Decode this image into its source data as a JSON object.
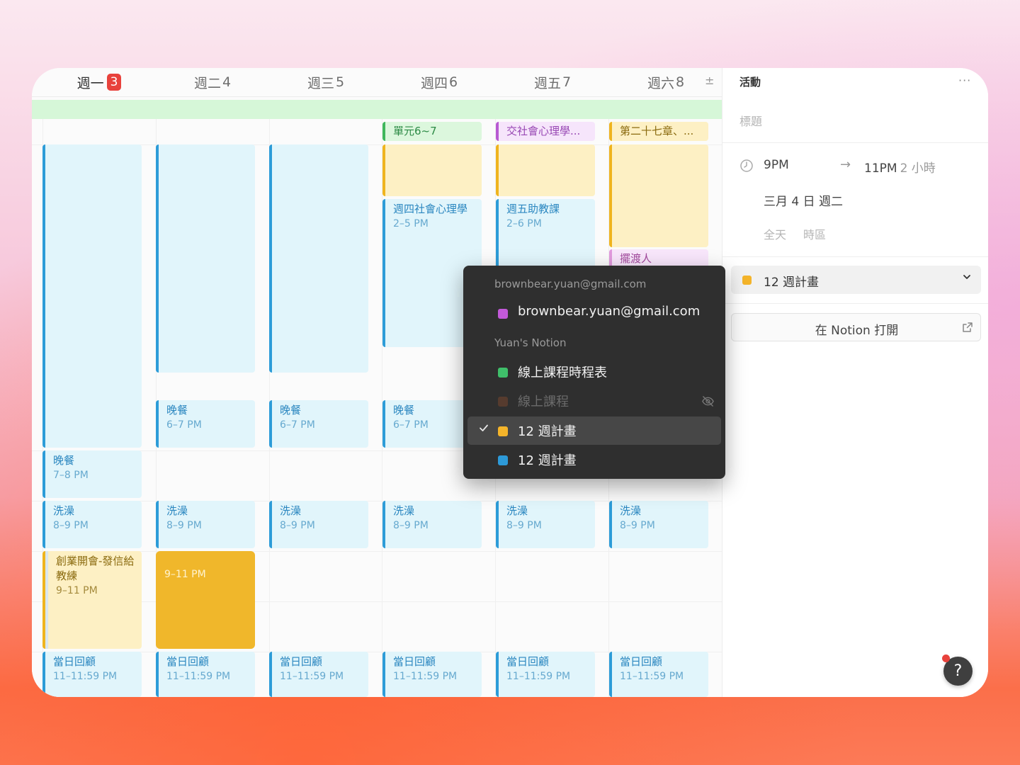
{
  "calendar": {
    "days": [
      {
        "name": "週一",
        "num": "3",
        "today": true
      },
      {
        "name": "週二",
        "num": "4"
      },
      {
        "name": "週三",
        "num": "5"
      },
      {
        "name": "週四",
        "num": "6"
      },
      {
        "name": "週五",
        "num": "7"
      },
      {
        "name": "週六",
        "num": "8"
      }
    ],
    "expand_symbol": "±",
    "allday_events": {
      "thu": "單元6~7",
      "fri": "交社會心理學...",
      "sat": "第二十七章、..."
    },
    "events": {
      "thu_social": {
        "title": "週四社會心理學",
        "time": "2–5 PM"
      },
      "fri_ta": {
        "title": "週五助教課",
        "time": "2–6 PM"
      },
      "sat_ferry": {
        "title": "擺渡人"
      },
      "mon_dinner": {
        "title": "晚餐",
        "time": "7–8 PM"
      },
      "tue_dinner": {
        "title": "晚餐",
        "time": "6–7 PM"
      },
      "wed_dinner": {
        "title": "晚餐",
        "time": "6–7 PM"
      },
      "thu_dinner": {
        "title": "晚餐",
        "time": "6–7 PM"
      },
      "bath": {
        "title": "洗澡",
        "time": "8–9 PM"
      },
      "mon_meeting": {
        "title": "創業開會-發信給教練",
        "time": "9–11 PM"
      },
      "tue_selected": {
        "time": "9–11 PM"
      },
      "review": {
        "title": "當日回顧",
        "time": "11–11:59 PM"
      }
    }
  },
  "panel": {
    "title": "活動",
    "more": "···",
    "title_placeholder": "標題",
    "start": "9PM",
    "end": "11PM",
    "duration": "2 小時",
    "date": "三月 4 日 週二",
    "all_day": "全天",
    "timezone": "時區",
    "calendar_selected": "12 週計畫",
    "calendar_color": "#f4b42a",
    "open_in_notion": "在 Notion 打開",
    "help": "?"
  },
  "dropdown": {
    "section_google": "brownbear.yuan@gmail.com",
    "items_google": [
      {
        "label": "brownbear.yuan@gmail.com",
        "color": "#c259d9"
      }
    ],
    "section_notion": "Yuan's Notion",
    "items_notion": [
      {
        "label": "線上課程時程表",
        "color": "#3fbf6a"
      },
      {
        "label": "線上課程",
        "color": "#a0532d",
        "hidden": true
      },
      {
        "label": "12 週計畫",
        "color": "#f4b42a",
        "selected": true
      },
      {
        "label": "12 週計畫",
        "color": "#2d9ad8"
      }
    ]
  }
}
